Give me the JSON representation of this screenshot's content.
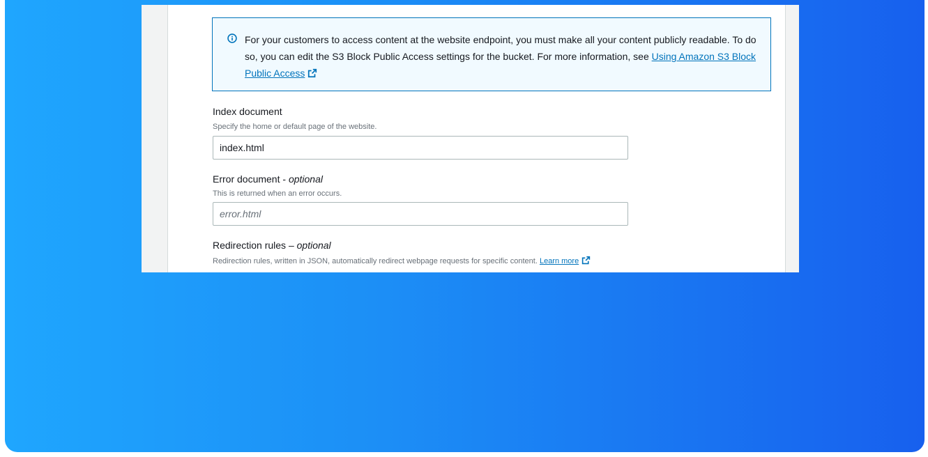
{
  "info": {
    "text": "For your customers to access content at the website endpoint, you must make all your content publicly readable. To do so, you can edit the S3 Block Public Access settings for the bucket. For more information, see",
    "link": "Using Amazon S3 Block Public Access",
    "icon": "info-circle-icon",
    "link_icon": "external-link-icon"
  },
  "index_document": {
    "label": "Index document",
    "description": "Specify the home or default page of the website.",
    "value": "index.html"
  },
  "error_document": {
    "label": "Error document - ",
    "label_optional": "optional",
    "description": "This is returned when an error occurs.",
    "placeholder": "error.html"
  },
  "redirection_rules": {
    "label": "Redirection rules – ",
    "label_optional": "optional",
    "description": "Redirection rules, written in JSON, automatically redirect webpage requests for specific content.",
    "link": "Learn more",
    "link_icon": "external-link-icon"
  },
  "colors": {
    "info_border": "#0073bb",
    "info_background": "#f1faff",
    "link": "#0073bb",
    "gradient_start": "#1fa6fe",
    "gradient_end": "#1760ee"
  }
}
